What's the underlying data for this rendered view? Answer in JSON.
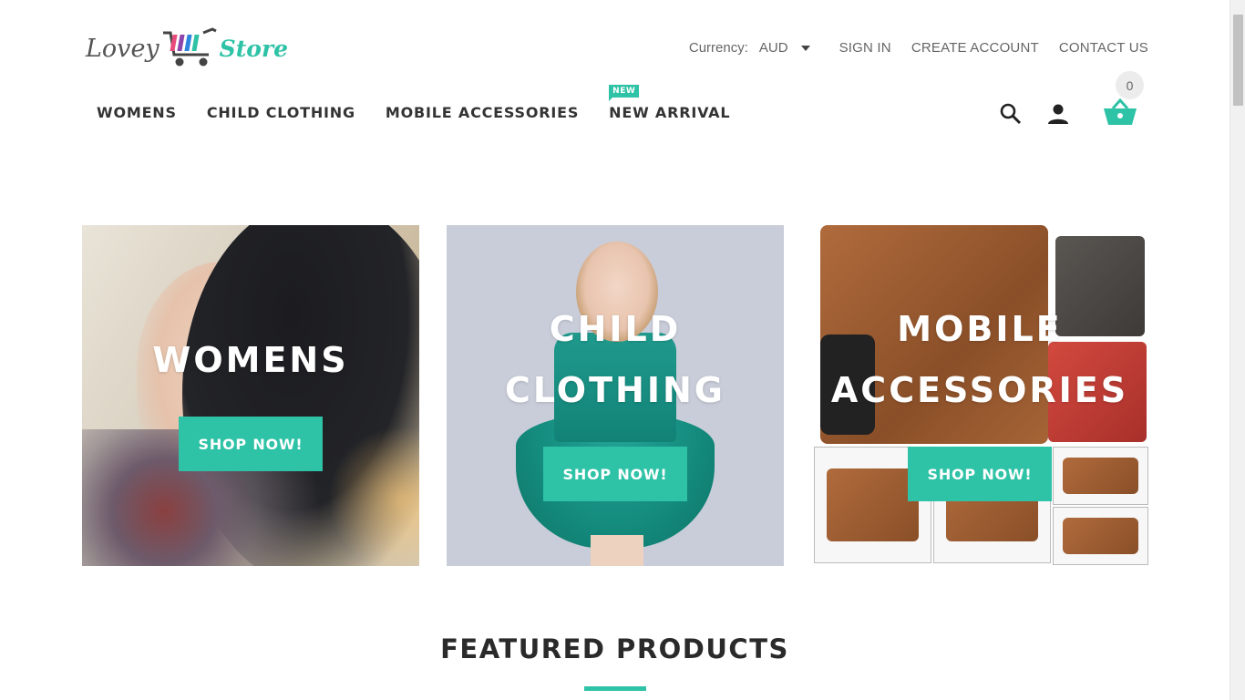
{
  "header": {
    "logo": {
      "text_left": "Lovey",
      "text_right": "Store"
    },
    "currency": {
      "label": "Currency:",
      "value": "AUD"
    },
    "links": {
      "sign_in": "SIGN IN",
      "create_account": "CREATE ACCOUNT",
      "contact_us": "CONTACT US"
    },
    "nav": [
      {
        "label": "WOMENS"
      },
      {
        "label": "CHILD CLOTHING"
      },
      {
        "label": "MOBILE ACCESSORIES"
      },
      {
        "label": "NEW ARRIVAL",
        "badge": "NEW"
      }
    ],
    "icons": {
      "search": "search-icon",
      "account": "user-icon",
      "cart": "cart-icon"
    },
    "cart_count": "0"
  },
  "banners": [
    {
      "title_line1": "WOMENS",
      "button": "SHOP NOW!"
    },
    {
      "title_line1": "CHILD",
      "title_line2": "CLOTHING",
      "button": "SHOP NOW!"
    },
    {
      "title_line1": "MOBILE",
      "title_line2": "ACCESSORIES",
      "button": "SHOP NOW!"
    }
  ],
  "featured": {
    "title": "FEATURED PRODUCTS"
  },
  "colors": {
    "accent": "#2ec2a6",
    "text": "#333333",
    "muted": "#666666"
  }
}
